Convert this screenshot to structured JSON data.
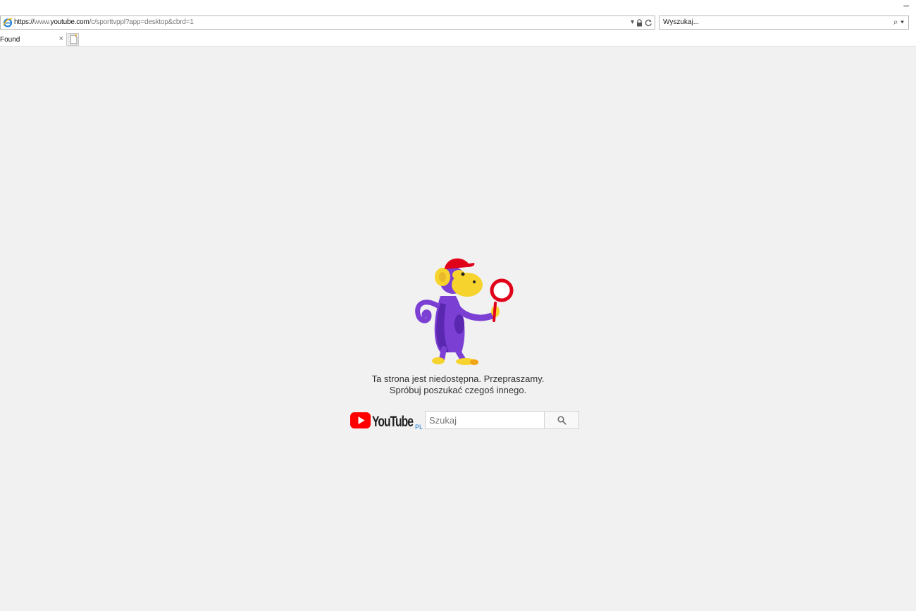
{
  "browser": {
    "address": {
      "protocol": "https://",
      "subdomain": "www.",
      "host": "youtube.com",
      "path": "/c/sporttvppl?app=desktop&cbrd=1"
    },
    "search_placeholder": "Wyszukaj...",
    "tab": {
      "title": "Found",
      "close_glyph": "×"
    },
    "minimize_glyph": "–",
    "icons": [
      "ie-icon",
      "dropdown-arrow-icon",
      "lock-icon",
      "refresh-icon",
      "search-icon",
      "new-tab-icon"
    ]
  },
  "page": {
    "illustration": "monkey-with-magnifier",
    "message_line1": "Ta strona jest niedostępna. Przepraszamy.",
    "message_line2": "Spróbuj poszukać czegoś innego.",
    "logo": {
      "wordmark": "YouTube",
      "region": "PL"
    },
    "search": {
      "placeholder": "Szukaj",
      "value": ""
    },
    "colors": {
      "background": "#f1f1f1",
      "brand_red": "#ff0000",
      "region_blue": "#1f7dd6",
      "monkey_purple": "#7b3fd4",
      "monkey_yellow": "#f6d32d"
    }
  }
}
